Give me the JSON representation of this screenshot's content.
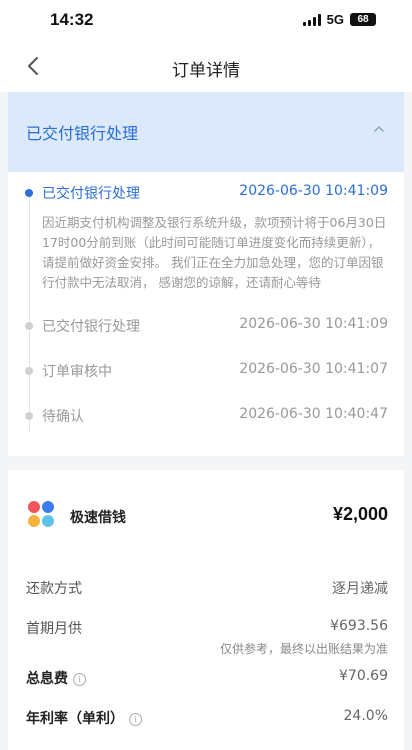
{
  "status_bar": {
    "time": "14:32",
    "network": "5G",
    "battery": "68"
  },
  "nav": {
    "title": "订单详情"
  },
  "order_status": {
    "title": "已交付银行处理",
    "timeline": [
      {
        "title": "已交付银行处理",
        "time": "2026-06-30 10:41:09",
        "desc": "因近期支付机构调整及银行系统升级，款项预计将于06月30日17时00分前到账（此时间可能随订单进度变化而持续更新）， 请提前做好资金安排。 我们正在全力加急处理，您的订单因银行付款中无法取消， 感谢您的谅解，还请耐心等待",
        "active": true
      },
      {
        "title": "已交付银行处理",
        "time": "2026-06-30 10:41:09"
      },
      {
        "title": "订单审核中",
        "time": "2026-06-30 10:41:07"
      },
      {
        "title": "待确认",
        "time": "2026-06-30 10:40:47"
      }
    ]
  },
  "loan": {
    "product_name": "极速借钱",
    "amount": "¥2,000",
    "repay_label": "还款方式",
    "repay_value": "逐月递减",
    "first_month_label": "首期月供",
    "first_month_value": "¥693.56",
    "first_month_note": "仅供参考，最终以出账结果为准",
    "interest_label": "总息费",
    "interest_value": "¥70.69",
    "rate_label": "年利率（单利）",
    "rate_value": "24.0%"
  },
  "colors": {
    "accent": "#2b6fd6",
    "status_bg": "#dbe9fb"
  },
  "icons": {
    "back": "chevron-left-icon",
    "collapse": "chevron-up-icon",
    "info": "info-icon",
    "product": "product-logo-icon"
  }
}
